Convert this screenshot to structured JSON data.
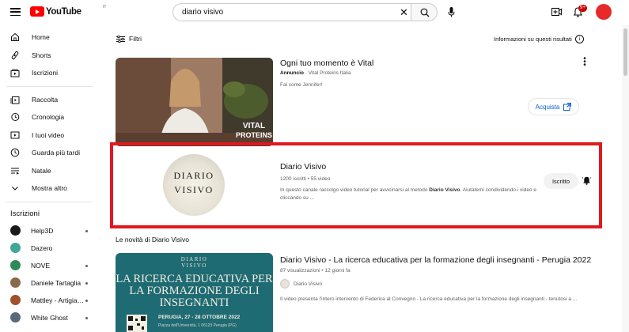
{
  "header": {
    "logo_text": "YouTube",
    "logo_country": "IT",
    "search_value": "diario visivo",
    "notification_badge": "9+"
  },
  "sidebar": {
    "main_items": [
      {
        "label": "Home",
        "icon": "home-icon"
      },
      {
        "label": "Shorts",
        "icon": "shorts-icon"
      },
      {
        "label": "Iscrizioni",
        "icon": "subscriptions-icon"
      }
    ],
    "library_items": [
      {
        "label": "Raccolta",
        "icon": "library-icon"
      },
      {
        "label": "Cronologia",
        "icon": "history-icon"
      },
      {
        "label": "I tuoi video",
        "icon": "your-videos-icon"
      },
      {
        "label": "Guarda più tardi",
        "icon": "watch-later-icon"
      },
      {
        "label": "Natale",
        "icon": "playlist-icon"
      },
      {
        "label": "Mostra altro",
        "icon": "chevron-down-icon"
      }
    ],
    "subscriptions_title": "Iscrizioni",
    "subscriptions": [
      {
        "label": "Help3D",
        "color": "#1a1a1a",
        "new": true
      },
      {
        "label": "Dazero",
        "color": "#3fa796",
        "new": false
      },
      {
        "label": "NOVE",
        "color": "#2e8b57",
        "new": true
      },
      {
        "label": "Daniele Tartaglia",
        "color": "#8a6a4a",
        "new": true
      },
      {
        "label": "Mattley - Artigiani...",
        "color": "#a0502a",
        "new": true
      },
      {
        "label": "White Ghost",
        "color": "#5a6a7a",
        "new": true
      }
    ]
  },
  "filters": {
    "label": "Filtri",
    "info_text": "Informazioni su questi risultati"
  },
  "ad": {
    "title": "Ogni tuo momento è Vital",
    "label": "Annuncio",
    "advertiser": "Vital Proteins Italia",
    "description": "Fai come Jennifer!",
    "cta": "Acquista",
    "thumb_text_1": "VITAL",
    "thumb_text_2": "PROTEINS"
  },
  "channel": {
    "name": "Diario Visivo",
    "stats": "1200 iscritti • 55 video",
    "description_pre": "In questo canale raccolgo video tutorial per avvicinarsi al metodo ",
    "description_bold": "Diario Visivo",
    "description_post": ". Aiutatemi condividendo i video e cliccando su ...",
    "subscribe_label": "Iscritto",
    "avatar_line1": "DIARIO",
    "avatar_line2": "VISIVO"
  },
  "section": {
    "title": "Le novità di Diario Visivo"
  },
  "video": {
    "title": "Diario Visivo - La ricerca educativa per la formazione degli insegnanti - Perugia 2022",
    "meta": "87 visualizzazioni • 12 giorni fa",
    "channel": "Diario Visivo",
    "description": "Il video presenta l'intero intervento di Federica al Convegno - La ricerca educativa per la formazione degli insegnanti - tenutosi a ...",
    "thumb_brand_1": "DIARIO",
    "thumb_brand_2": "VISIVO",
    "thumb_heading": "LA RICERCA EDUCATIVA PER LA FORMAZIONE DEGLI INSEGNANTI",
    "thumb_event": "PERUGIA, 27 - 28 OTTOBRE 2022",
    "thumb_place": "Piazza dell'Università, 1 06123 Perugia (PG)"
  },
  "colors": {
    "accent_red": "#ff0000",
    "highlight_box": "#e0191f",
    "link_blue": "#065fd4",
    "thumb_teal": "#1f6b73"
  }
}
